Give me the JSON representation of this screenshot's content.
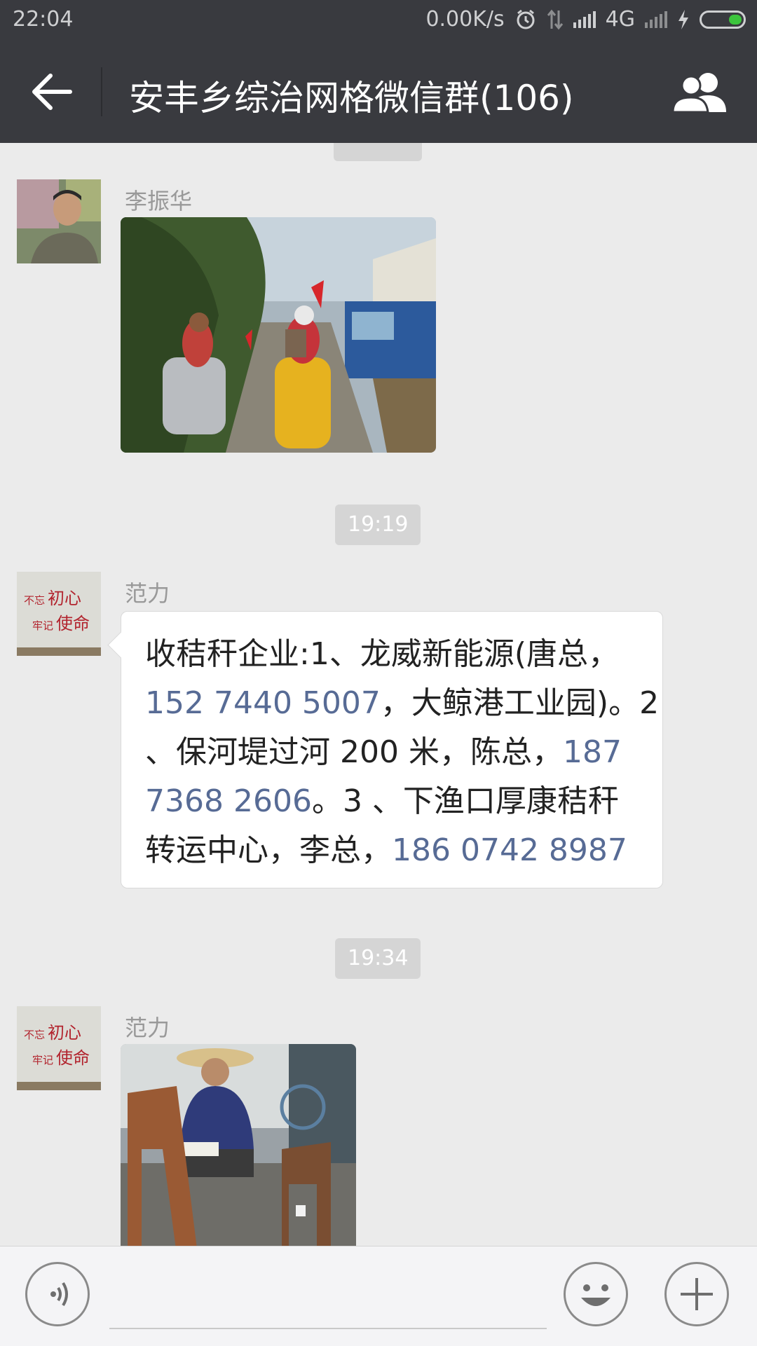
{
  "status_bar": {
    "time": "22:04",
    "net_speed": "0.00K/s",
    "network": "4G"
  },
  "header": {
    "title": "安丰乡综治网格微信群(106)"
  },
  "messages": [
    {
      "type": "image",
      "sender": "李振华"
    },
    {
      "type": "timestamp",
      "time": "19:19"
    },
    {
      "type": "text",
      "sender": "范力",
      "lines": [
        [
          {
            "t": "收秸秆企业:1、龙威新能源(唐总，"
          }
        ],
        [
          {
            "t": "152 7440 5007",
            "phone": true
          },
          {
            "t": "，大鲸港工业园)。2"
          }
        ],
        [
          {
            "t": "、保河堤过河 200 米，陈总，"
          },
          {
            "t": "187",
            "phone": true
          }
        ],
        [
          {
            "t": "7368 2606",
            "phone": true
          },
          {
            "t": "。3 、下渔口厚康秸秆"
          }
        ],
        [
          {
            "t": "转运中心，李总，"
          },
          {
            "t": "186 0742 8987",
            "phone": true
          }
        ]
      ]
    },
    {
      "type": "timestamp",
      "time": "19:34"
    },
    {
      "type": "image",
      "sender": "范力"
    }
  ],
  "avatars": {
    "fanli_text": [
      "不忘",
      "初心",
      "牢记",
      "使命"
    ]
  },
  "colors": {
    "bar": "#393a3f",
    "chat_bg": "#ebebeb",
    "link": "#576b95"
  }
}
